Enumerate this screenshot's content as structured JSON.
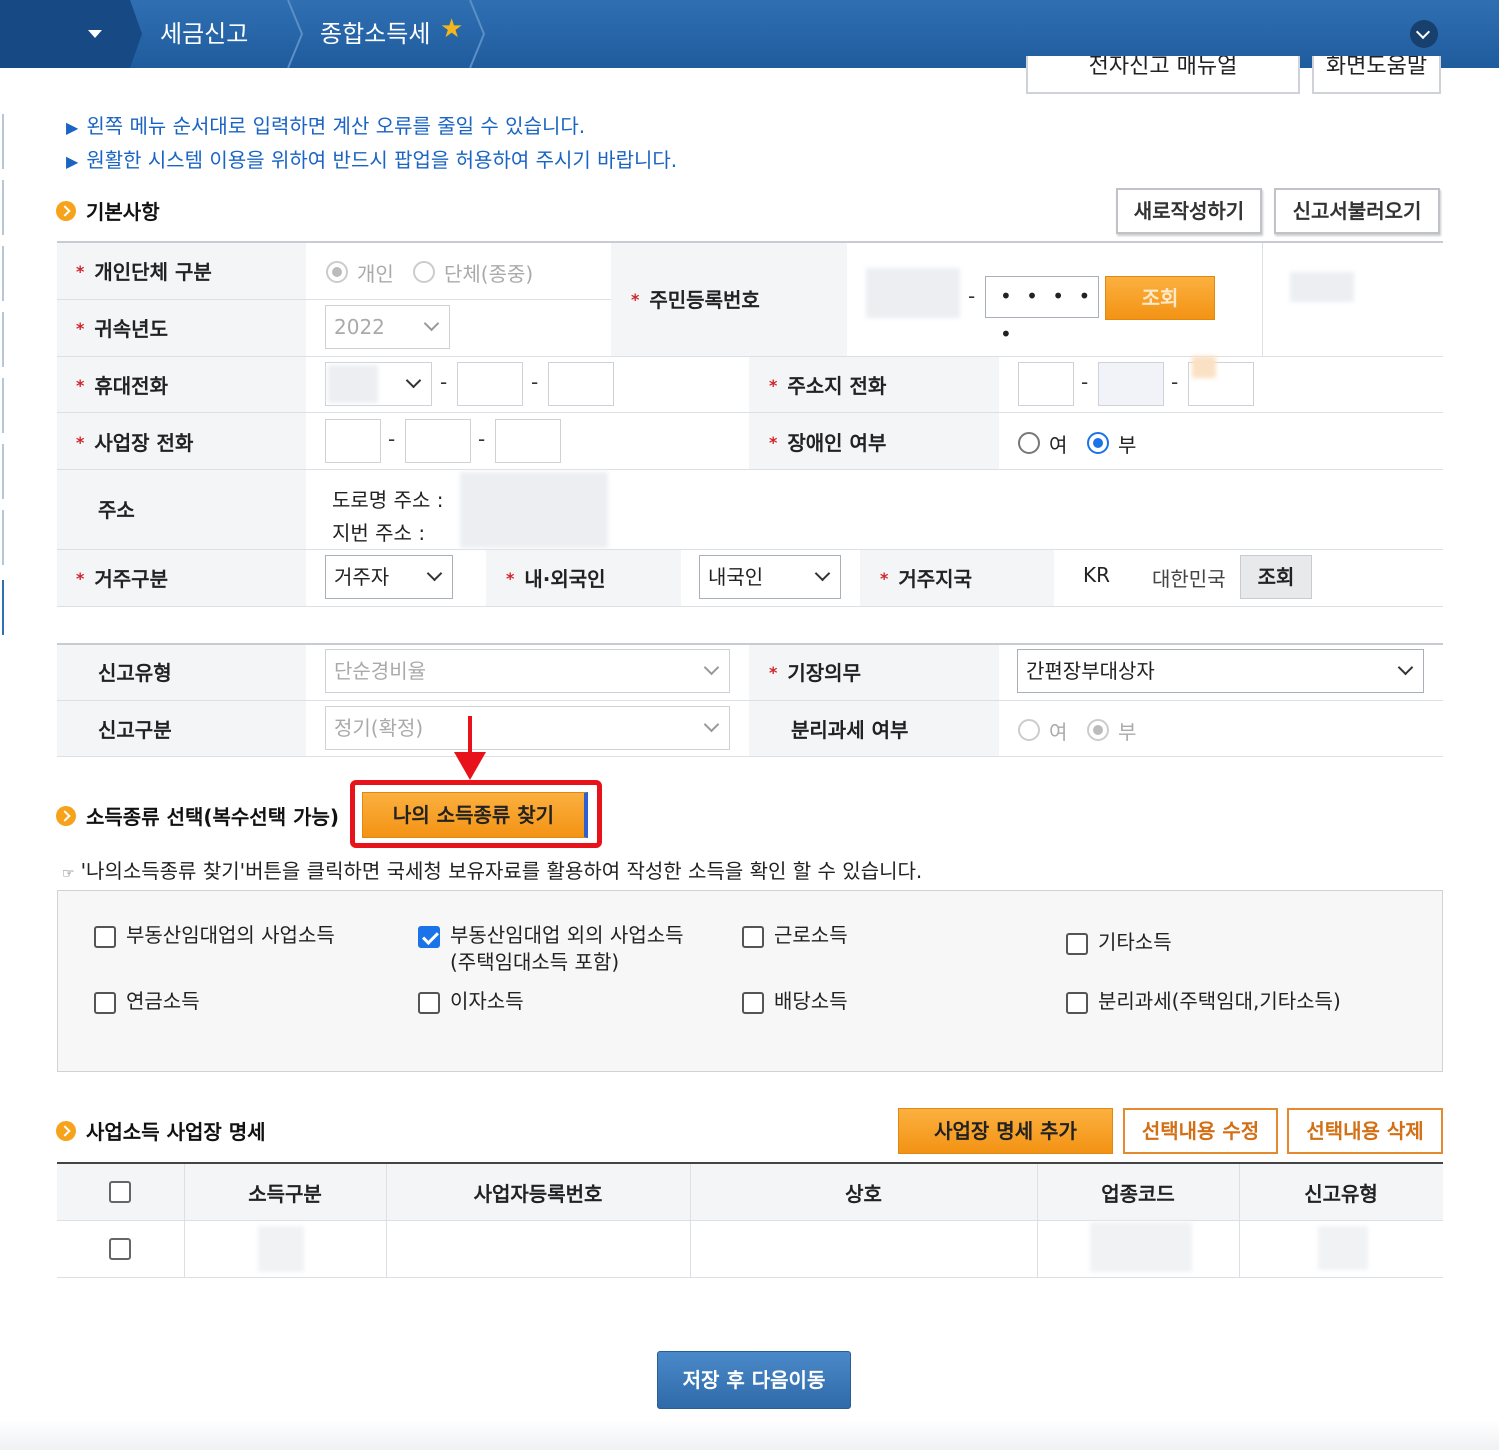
{
  "topnav": {
    "crumb1": "세금신고",
    "crumb2": "종합소득세",
    "colors": {
      "bar": "#2f6fb2",
      "star": "#f5b61a"
    }
  },
  "header_buttons": {
    "manual": "전자신고 매뉴얼",
    "form": "화면도움말"
  },
  "notices": [
    "왼쪽 메뉴 순서대로 입력하면 계산 오류를 줄일 수 있습니다.",
    "원활한 시스템 이용을 위하여 반드시 팝업을 허용하여 주시기 바랍니다."
  ],
  "basic": {
    "title": "기본사항",
    "new_btn": "새로작성하기",
    "load_btn": "신고서불러오기",
    "type_label": "개인단체 구분",
    "type_opt1": "개인",
    "type_opt2": "단체(종중)",
    "year_label": "귀속년도",
    "year_value": "2022",
    "rrn_label": "주민등록번호",
    "rrn_masked": "• • • • •",
    "lookup_btn": "조회",
    "mobile_label": "휴대전화",
    "home_phone_label": "주소지 전화",
    "biz_phone_label": "사업장 전화",
    "disabled_label": "장애인 여부",
    "yes": "여",
    "no": "부",
    "addr_label": "주소",
    "road_addr": "도로명 주소 :",
    "lot_addr": "지번 주소 :",
    "residence_label": "거주구분",
    "residence_value": "거주자",
    "nationality_label": "내·외국인",
    "nationality_value": "내국인",
    "country_label": "거주지국",
    "country_code": "KR",
    "country_name": "대한민국",
    "country_btn": "조회",
    "report_type_label": "신고유형",
    "report_type_value": "단순경비율",
    "bookkeeping_label": "기장의무",
    "bookkeeping_value": "간편장부대상자",
    "report_kind_label": "신고구분",
    "report_kind_value": "정기(확정)",
    "separate_label": "분리과세 여부"
  },
  "income": {
    "title": "소득종류 선택(복수선택 가능)",
    "find_btn": "나의 소득종류 찾기",
    "hint": "'나의소득종류 찾기'버튼을 클릭하면 국세청 보유자료를 활용하여 작성한 소득을 확인 할 수 있습니다.",
    "hint_icon": "☞",
    "options": [
      {
        "label": "부동산임대업의 사업소득",
        "checked": false
      },
      {
        "label": "부동산임대업 외의 사업소득",
        "label2": "(주택임대소득 포함)",
        "checked": true
      },
      {
        "label": "근로소득",
        "checked": false
      },
      {
        "label": "기타소득",
        "checked": false
      },
      {
        "label": "연금소득",
        "checked": false
      },
      {
        "label": "이자소득",
        "checked": false
      },
      {
        "label": "배당소득",
        "checked": false
      },
      {
        "label": "분리과세(주택임대,기타소득)",
        "checked": false
      }
    ]
  },
  "biz": {
    "title": "사업소득 사업장 명세",
    "add_btn": "사업장 명세 추가",
    "edit_btn": "선택내용 수정",
    "del_btn": "선택내용 삭제",
    "columns": [
      "소득구분",
      "사업자등록번호",
      "상호",
      "업종코드",
      "신고유형"
    ]
  },
  "save_btn": "저장 후 다음이동"
}
